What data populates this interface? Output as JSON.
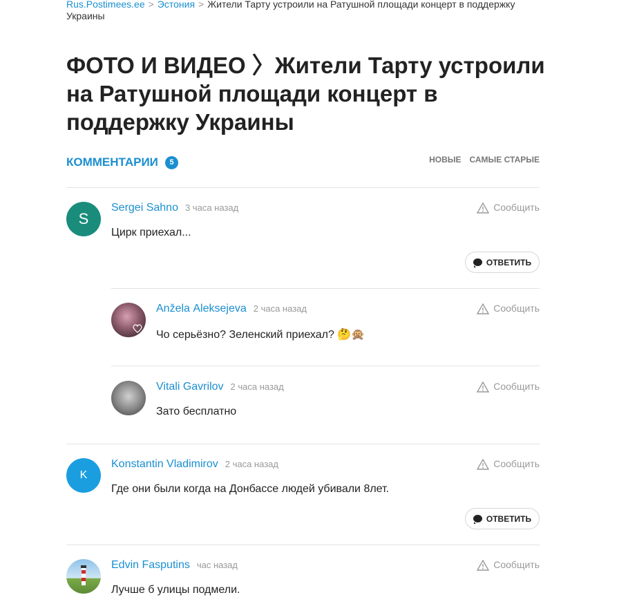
{
  "breadcrumb": {
    "site": "Rus.Postimees.ee",
    "section": "Эстония",
    "separator": ">",
    "current": "Жители Тарту устроили на Ратушной площади концерт в поддержку Украины"
  },
  "article": {
    "title": "ФОТО И ВИДЕО 〉Жители Тарту устроили на Ратушной площади концерт в поддержку Украины"
  },
  "comments_section": {
    "title": "КОММЕНТАРИИ",
    "count": "5",
    "sort_newest": "НОВЫЕ",
    "sort_oldest": "САМЫЕ СТАРЫЕ",
    "report_label": "Сообщить",
    "reply_label": "ОТВЕТИТЬ"
  },
  "comments": [
    {
      "author": "Sergei Sahno",
      "time": "3 часа назад",
      "text": "Цирк приехал...",
      "avatar_letter": "S",
      "avatar_color": "#1a8c7c"
    },
    {
      "author": "Anželа Aleksejeva",
      "time": "2 часа назад",
      "text": "Чо серьёзно? Зеленский приехал? 🤔🙊",
      "avatar_letter": "",
      "avatar_color": "#b09aa8"
    },
    {
      "author": "Vitali Gavrilov",
      "time": "2 часа назад",
      "text": "Зато бесплатно",
      "avatar_letter": "",
      "avatar_color": "#8a8a8a"
    },
    {
      "author": "Konstantin Vladimirov",
      "time": "2 часа назад",
      "text": "Где они были когда на Донбассе людей убивали 8лет.",
      "avatar_letter": "K",
      "avatar_color": "#1a9ee0"
    },
    {
      "author": "Edvin Fasputins",
      "time": "час назад",
      "text": "Лучше б улицы подмели.",
      "avatar_letter": "",
      "avatar_color": "#8fc2e8"
    }
  ],
  "colors": {
    "accent": "#1a8fd0",
    "divider": "#e2e2e2"
  }
}
